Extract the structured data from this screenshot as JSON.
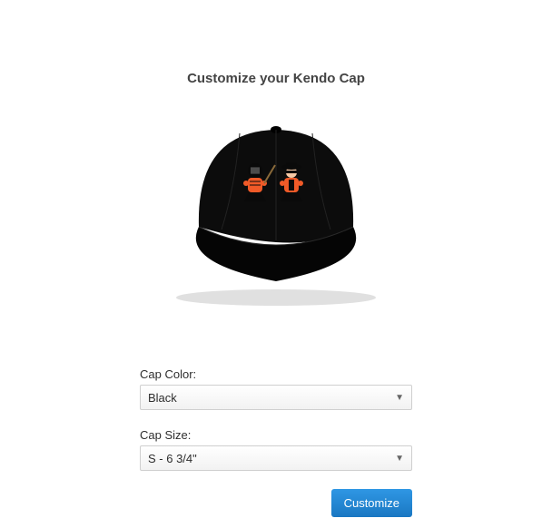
{
  "title": "Customize your Kendo Cap",
  "product_image": {
    "name": "kendo-cap-black",
    "accent_color": "#f05a28"
  },
  "form": {
    "cap_color": {
      "label": "Cap Color:",
      "value": "Black"
    },
    "cap_size": {
      "label": "Cap Size:",
      "value": "S - 6 3/4\""
    }
  },
  "actions": {
    "customize_label": "Customize"
  },
  "colors": {
    "primary_button": "#1e87d6"
  }
}
